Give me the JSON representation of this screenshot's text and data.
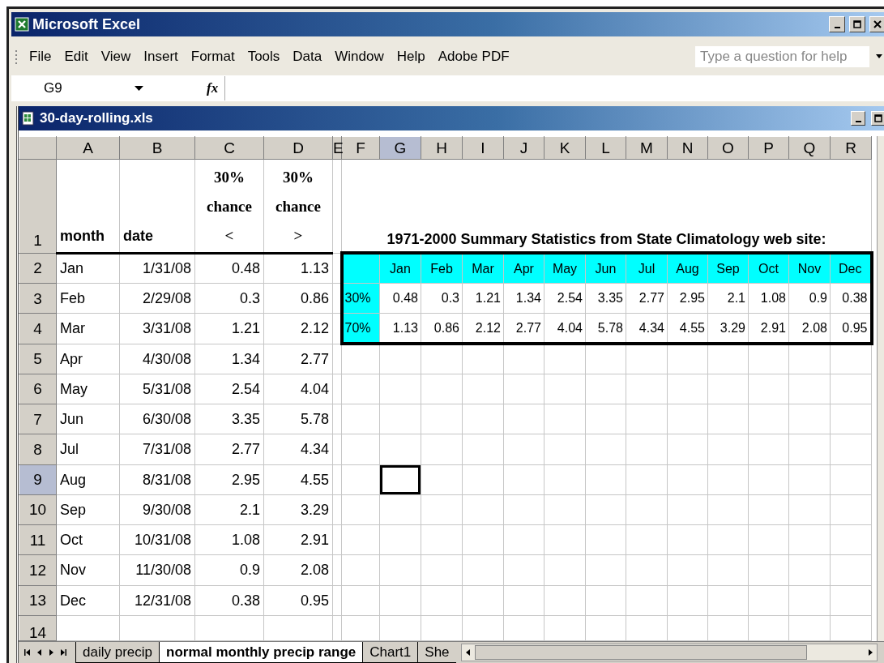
{
  "window": {
    "title": "Microsoft Excel"
  },
  "menu": [
    "File",
    "Edit",
    "View",
    "Insert",
    "Format",
    "Tools",
    "Data",
    "Window",
    "Help",
    "Adobe PDF"
  ],
  "help_search": {
    "placeholder": "Type a question for help"
  },
  "formula_bar": {
    "name_box": "G9",
    "fx_label": "fx"
  },
  "workbook": {
    "title": "30-day-rolling.xls"
  },
  "columns": [
    {
      "label": "A",
      "selected": false
    },
    {
      "label": "B",
      "selected": false
    },
    {
      "label": "C",
      "selected": false
    },
    {
      "label": "D",
      "selected": false
    },
    {
      "label": "E",
      "selected": false
    },
    {
      "label": "F",
      "selected": false
    },
    {
      "label": "G",
      "selected": true
    },
    {
      "label": "H",
      "selected": false
    },
    {
      "label": "I",
      "selected": false
    },
    {
      "label": "J",
      "selected": false
    },
    {
      "label": "K",
      "selected": false
    },
    {
      "label": "L",
      "selected": false
    },
    {
      "label": "M",
      "selected": false
    },
    {
      "label": "N",
      "selected": false
    },
    {
      "label": "O",
      "selected": false
    },
    {
      "label": "P",
      "selected": false
    },
    {
      "label": "Q",
      "selected": false
    },
    {
      "label": "R",
      "selected": false
    }
  ],
  "header_row": {
    "num": "1",
    "selected": false,
    "cells": [
      "month",
      "date",
      "30% chance <",
      "30% chance >"
    ]
  },
  "rows": [
    {
      "num": "2",
      "selected": false,
      "cells": [
        "Jan",
        "1/31/08",
        "0.48",
        "1.13"
      ]
    },
    {
      "num": "3",
      "selected": false,
      "cells": [
        "Feb",
        "2/29/08",
        "0.3",
        "0.86"
      ]
    },
    {
      "num": "4",
      "selected": false,
      "cells": [
        "Mar",
        "3/31/08",
        "1.21",
        "2.12"
      ]
    },
    {
      "num": "5",
      "selected": false,
      "cells": [
        "Apr",
        "4/30/08",
        "1.34",
        "2.77"
      ]
    },
    {
      "num": "6",
      "selected": false,
      "cells": [
        "May",
        "5/31/08",
        "2.54",
        "4.04"
      ]
    },
    {
      "num": "7",
      "selected": false,
      "cells": [
        "Jun",
        "6/30/08",
        "3.35",
        "5.78"
      ]
    },
    {
      "num": "8",
      "selected": false,
      "cells": [
        "Jul",
        "7/31/08",
        "2.77",
        "4.34"
      ]
    },
    {
      "num": "9",
      "selected": true,
      "cells": [
        "Aug",
        "8/31/08",
        "2.95",
        "4.55"
      ]
    },
    {
      "num": "10",
      "selected": false,
      "cells": [
        "Sep",
        "9/30/08",
        "2.1",
        "3.29"
      ]
    },
    {
      "num": "11",
      "selected": false,
      "cells": [
        "Oct",
        "10/31/08",
        "1.08",
        "2.91"
      ]
    },
    {
      "num": "12",
      "selected": false,
      "cells": [
        "Nov",
        "11/30/08",
        "0.9",
        "2.08"
      ]
    },
    {
      "num": "13",
      "selected": false,
      "cells": [
        "Dec",
        "12/31/08",
        "0.38",
        "0.95"
      ]
    },
    {
      "num": "14",
      "selected": false
    }
  ],
  "summary": {
    "title": "1971-2000 Summary Statistics from State Climatology web site:",
    "months": [
      "Jan",
      "Feb",
      "Mar",
      "Apr",
      "May",
      "Jun",
      "Jul",
      "Aug",
      "Sep",
      "Oct",
      "Nov",
      "Dec"
    ],
    "rows": [
      {
        "label": "30%",
        "values": [
          "0.48",
          "0.3",
          "1.21",
          "1.34",
          "2.54",
          "3.35",
          "2.77",
          "2.95",
          "2.1",
          "1.08",
          "0.9",
          "0.38"
        ]
      },
      {
        "label": "70%",
        "values": [
          "1.13",
          "0.86",
          "2.12",
          "2.77",
          "4.04",
          "5.78",
          "4.34",
          "4.55",
          "3.29",
          "2.91",
          "2.08",
          "0.95"
        ]
      }
    ]
  },
  "sheet_tabs": [
    {
      "label": "daily precip",
      "selected": false
    },
    {
      "label": "normal monthly precip range",
      "selected": true
    },
    {
      "label": "Chart1",
      "selected": false
    },
    {
      "label": "She",
      "selected": false
    }
  ]
}
